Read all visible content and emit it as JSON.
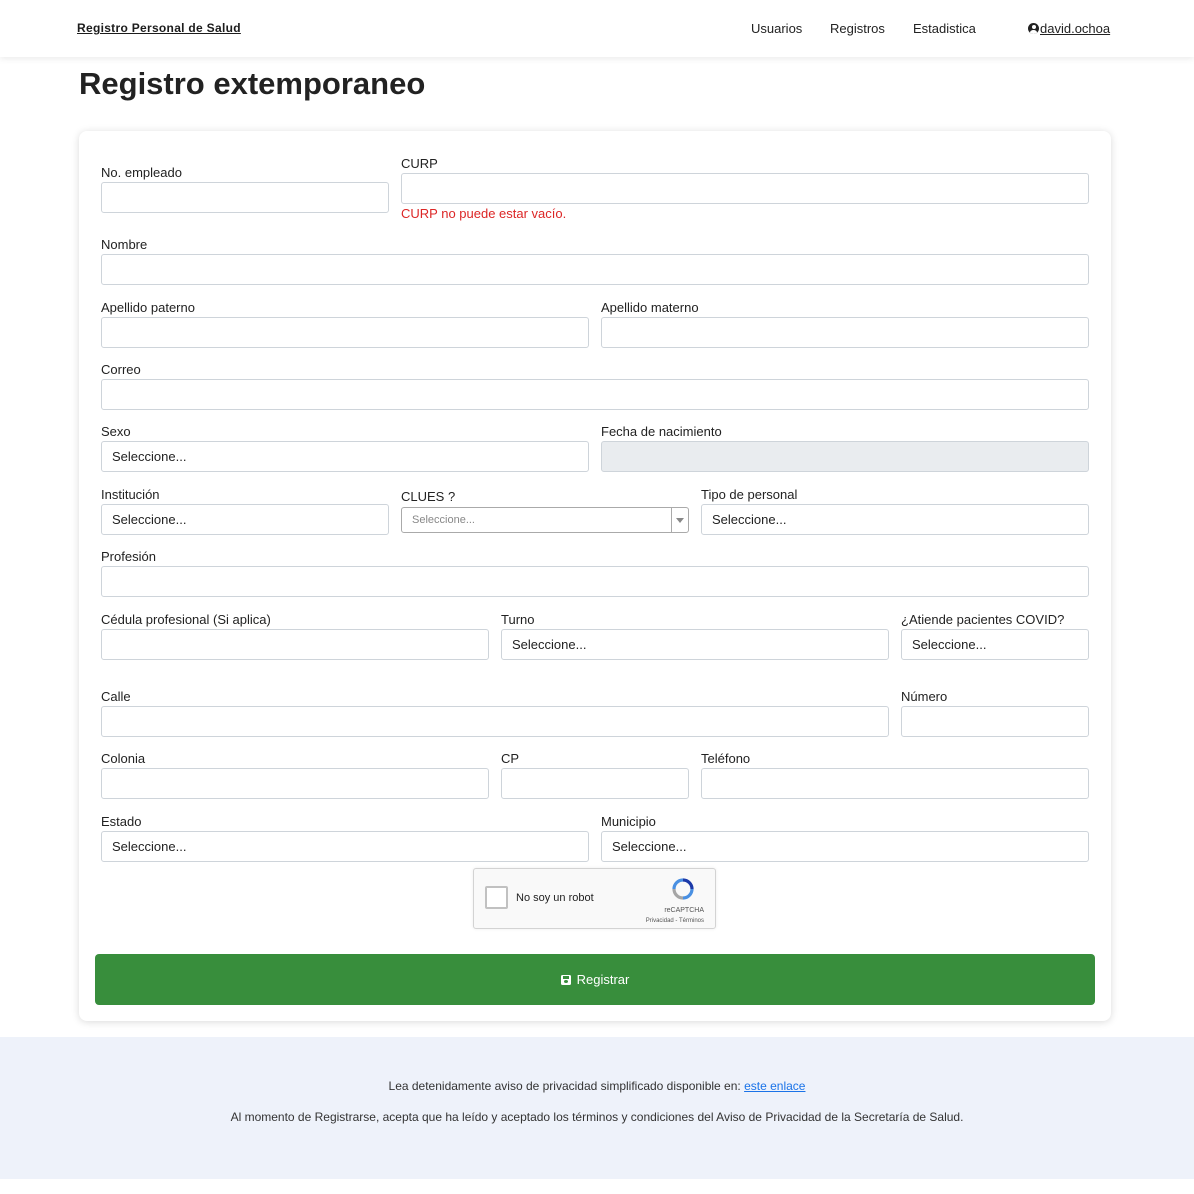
{
  "header": {
    "brand": "Registro Personal de Salud",
    "nav": [
      "Usuarios",
      "Registros",
      "Estadistica"
    ],
    "user": "david.ochoa"
  },
  "page_title": "Registro extemporaneo",
  "form": {
    "no_empleado": {
      "label": "No. empleado",
      "value": ""
    },
    "curp": {
      "label": "CURP",
      "value": "",
      "error": "CURP no puede estar vacío."
    },
    "nombre": {
      "label": "Nombre",
      "value": ""
    },
    "apellido_paterno": {
      "label": "Apellido paterno",
      "value": ""
    },
    "apellido_materno": {
      "label": "Apellido materno",
      "value": ""
    },
    "correo": {
      "label": "Correo",
      "value": ""
    },
    "sexo": {
      "label": "Sexo",
      "value": "Seleccione..."
    },
    "fecha_nacimiento": {
      "label": "Fecha de nacimiento",
      "value": ""
    },
    "institucion": {
      "label": "Institución",
      "value": "Seleccione..."
    },
    "clues": {
      "label": "CLUES ?",
      "value": "Seleccione..."
    },
    "tipo_personal": {
      "label": "Tipo de personal",
      "value": "Seleccione..."
    },
    "profesion": {
      "label": "Profesión",
      "value": ""
    },
    "cedula": {
      "label": "Cédula profesional (Si aplica)",
      "value": ""
    },
    "turno": {
      "label": "Turno",
      "value": "Seleccione..."
    },
    "covid": {
      "label": "¿Atiende pacientes COVID?",
      "value": "Seleccione..."
    },
    "calle": {
      "label": "Calle",
      "value": ""
    },
    "numero": {
      "label": "Número",
      "value": ""
    },
    "colonia": {
      "label": "Colonia",
      "value": ""
    },
    "cp": {
      "label": "CP",
      "value": ""
    },
    "telefono": {
      "label": "Teléfono",
      "value": ""
    },
    "estado": {
      "label": "Estado",
      "value": "Seleccione..."
    },
    "municipio": {
      "label": "Municipio",
      "value": "Seleccione..."
    }
  },
  "captcha": {
    "label": "No soy un robot",
    "brand": "reCAPTCHA",
    "terms": "Privacidad - Términos"
  },
  "submit_label": "Registrar",
  "footer": {
    "line1_text": "Lea detenidamente aviso de privacidad simplificado disponible en: ",
    "line1_link": "este enlace",
    "line2": "Al momento de Registrarse, acepta que ha leído y aceptado los términos y condiciones del Aviso de Privacidad de la Secretaría de Salud."
  },
  "colors": {
    "submit_bg": "#388e3c",
    "error_text": "#dc2626",
    "footer_bg": "#eef2fa",
    "link": "#1a73e8"
  }
}
